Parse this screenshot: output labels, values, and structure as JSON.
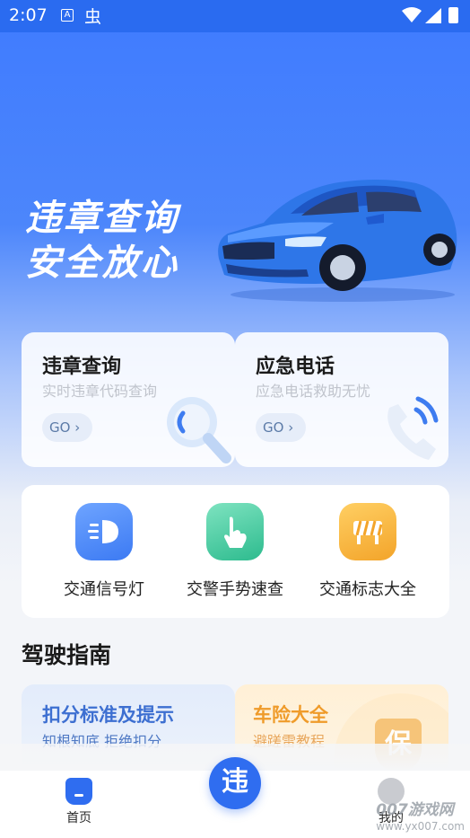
{
  "status_bar": {
    "time": "2:07",
    "icons": [
      "notification-a-icon",
      "bug-icon",
      "wifi-icon",
      "signal-icon",
      "battery-icon"
    ]
  },
  "hero": {
    "line1": "违章查询",
    "line2": "安全放心"
  },
  "feature_cards": [
    {
      "title": "违章查询",
      "subtitle": "实时违章代码查询",
      "button": "GO ›",
      "icon": "magnifier-icon"
    },
    {
      "title": "应急电话",
      "subtitle": "应急电话救助无忧",
      "button": "GO ›",
      "icon": "phone-icon"
    }
  ],
  "tools": [
    {
      "label": "交通信号灯",
      "icon": "headlight-icon",
      "color": "#3c7af3"
    },
    {
      "label": "交警手势速查",
      "icon": "hand-gesture-icon",
      "color": "#2dbb8e"
    },
    {
      "label": "交通标志大全",
      "icon": "road-barrier-icon",
      "color": "#f3a42a"
    }
  ],
  "section": {
    "title": "驾驶指南"
  },
  "guides": [
    {
      "title": "扣分标准及提示",
      "subtitle": "知根知底 拒绝扣分"
    },
    {
      "title": "车险大全",
      "subtitle": "避蹉雷教程",
      "badge": "保"
    }
  ],
  "bottom_nav": {
    "home_label": "首页",
    "center_glyph": "违",
    "me_label": "我的"
  },
  "watermark": {
    "line1": "007游戏网",
    "line2": "www.yx007.com"
  }
}
